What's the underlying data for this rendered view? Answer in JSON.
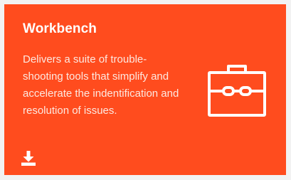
{
  "card": {
    "title": "Workbench",
    "description": "Delivers a suite of trouble-shooting tools that simplify and accelerate the indentification and resolution of issues.",
    "background_color": "#ff4c1e",
    "text_color": "#ffffff"
  },
  "icons": {
    "main": "toolbox-icon",
    "action": "download-icon"
  }
}
